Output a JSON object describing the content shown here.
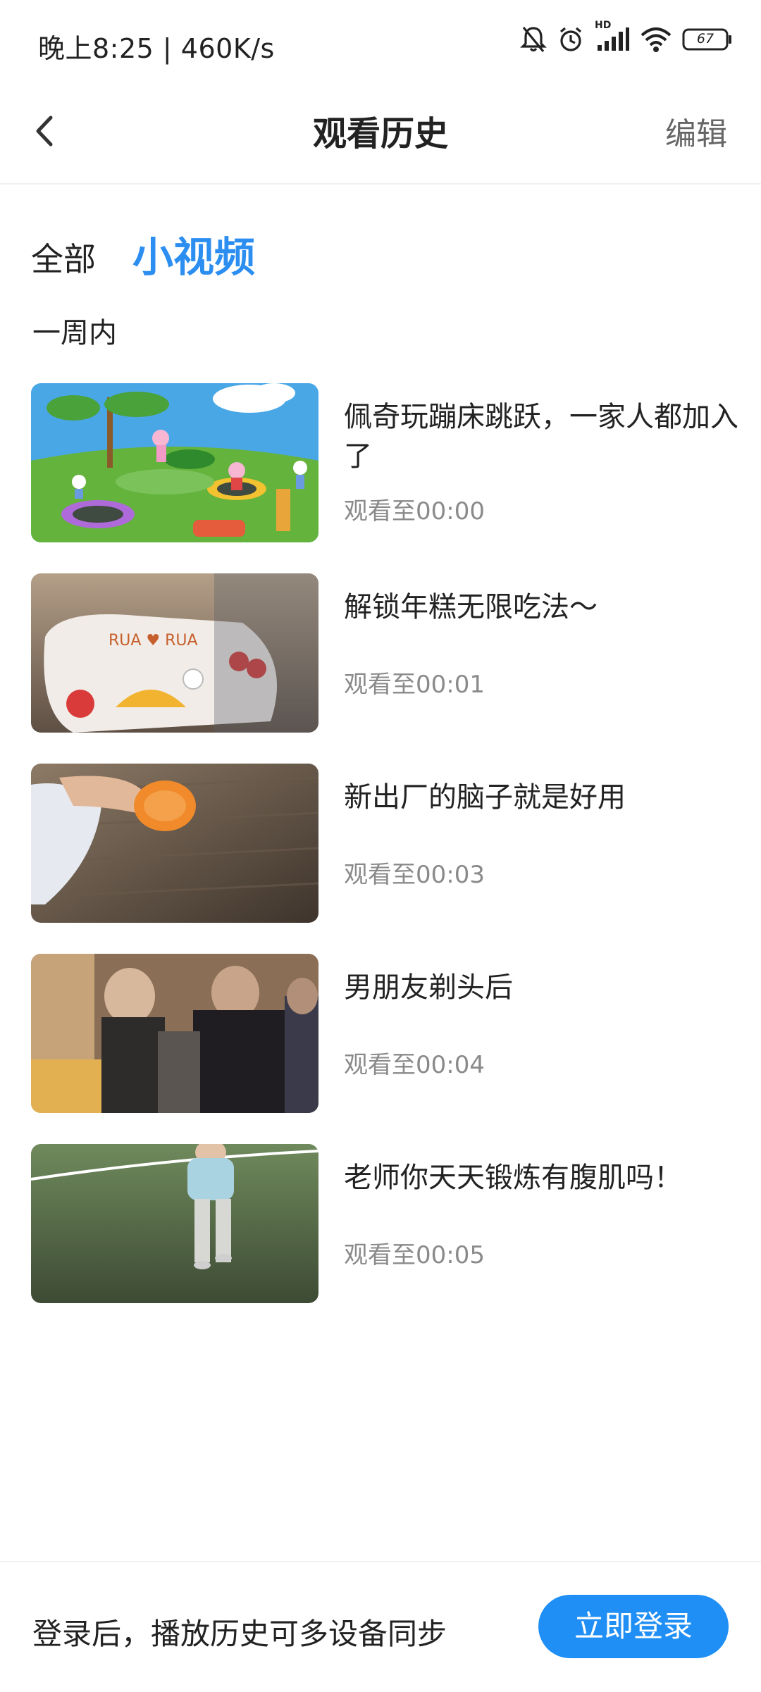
{
  "status_bar": {
    "time_speed": "晚上8:25 | 460K/s",
    "battery": "67",
    "network_badge": "HD",
    "icons": [
      "mute-bell-icon",
      "alarm-icon",
      "signal-icon",
      "wifi-icon",
      "battery-icon"
    ]
  },
  "header": {
    "title": "观看历史",
    "edit_label": "编辑",
    "back_icon": "chevron-left-icon"
  },
  "tabs": [
    {
      "label": "全部",
      "selected": false
    },
    {
      "label": "小视频",
      "selected": true
    }
  ],
  "section_label": "一周内",
  "items": [
    {
      "title": "佩奇玩蹦床跳跃，一家人都加入了",
      "progress": "观看至00:00"
    },
    {
      "title": "解锁年糕无限吃法～",
      "progress": "观看至00:01"
    },
    {
      "title": "新出厂的脑子就是好用",
      "progress": "观看至00:03"
    },
    {
      "title": "男朋友剃头后",
      "progress": "观看至00:04"
    },
    {
      "title": "老师你天天锻炼有腹肌吗！",
      "progress": "观看至00:05"
    }
  ],
  "footer": {
    "text": "登录后，播放历史可多设备同步",
    "login_label": "立即登录"
  },
  "colors": {
    "accent": "#2b8ef0",
    "button": "#1f8ff5",
    "muted_text": "#8a8a8a"
  }
}
